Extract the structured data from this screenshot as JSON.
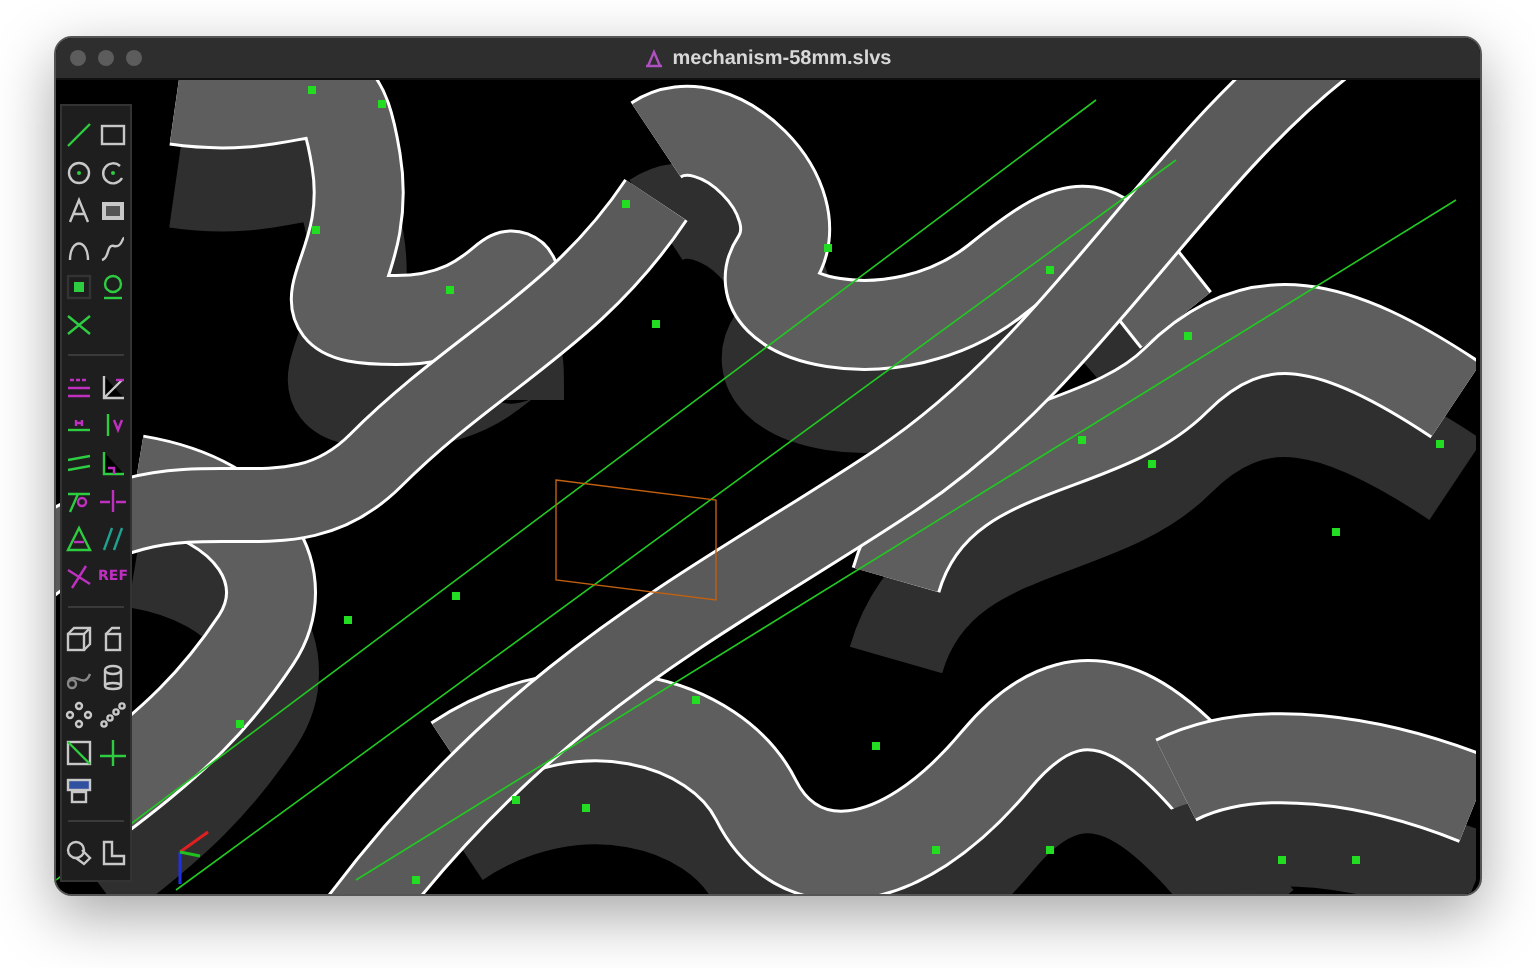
{
  "window": {
    "title": "mechanism-58mm.slvs"
  },
  "toolbar": {
    "reference_label": "REF"
  }
}
